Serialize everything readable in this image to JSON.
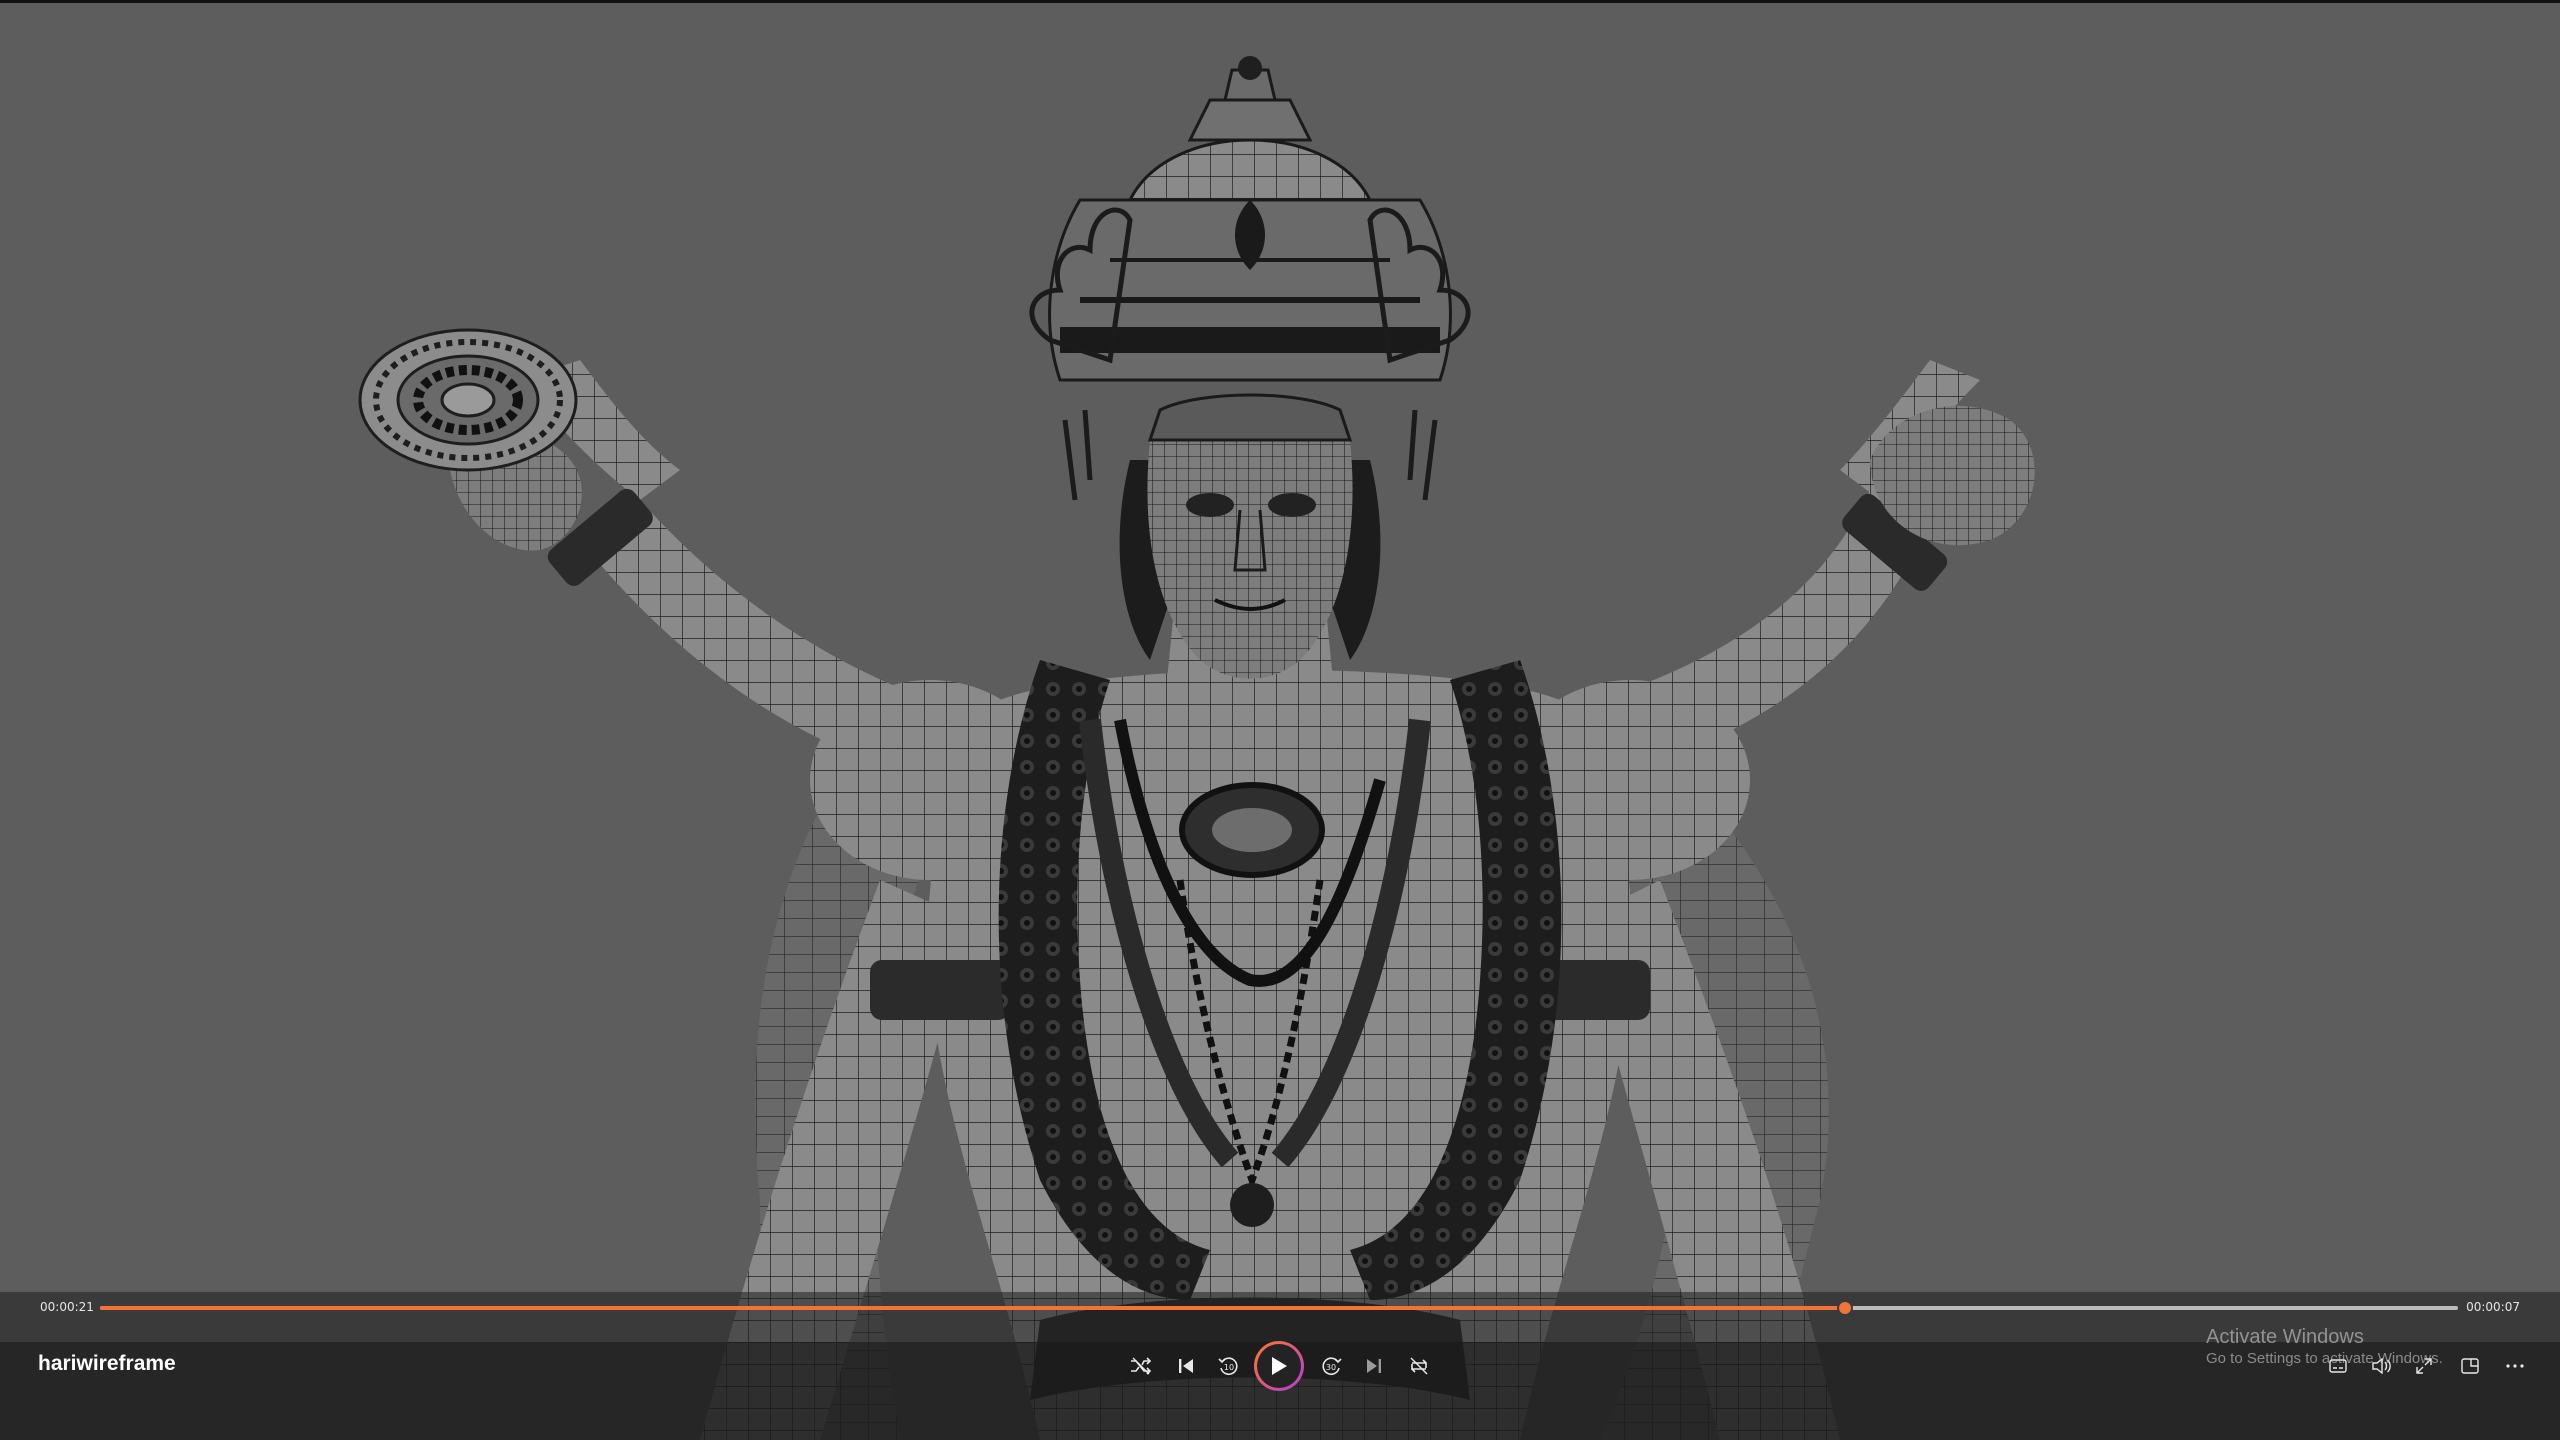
{
  "player": {
    "title": "hariwireframe",
    "time_elapsed": "00:00:21",
    "time_remaining": "00:00:07",
    "progress_fraction": 0.74,
    "accent_color": "#f0743a",
    "play_state": "paused"
  },
  "controls": [
    {
      "name": "shuffle-button",
      "icon": "shuffle-icon"
    },
    {
      "name": "previous-button",
      "icon": "skip-previous-icon"
    },
    {
      "name": "skip-back-button",
      "icon": "rewind-10-icon",
      "label": "10"
    },
    {
      "name": "play-button",
      "icon": "play-icon"
    },
    {
      "name": "skip-forward-button",
      "icon": "forward-30-icon",
      "label": "30"
    },
    {
      "name": "next-button",
      "icon": "skip-next-icon"
    },
    {
      "name": "repeat-button",
      "icon": "repeat-off-icon"
    }
  ],
  "right_controls": [
    {
      "name": "captions-button",
      "icon": "captions-icon"
    },
    {
      "name": "volume-button",
      "icon": "volume-icon"
    },
    {
      "name": "fullscreen-button",
      "icon": "expand-icon"
    },
    {
      "name": "miniplayer-button",
      "icon": "miniplayer-icon"
    },
    {
      "name": "more-button",
      "icon": "more-icon"
    }
  ],
  "watermark": {
    "title": "Activate Windows",
    "subtitle": "Go to Settings to activate Windows."
  },
  "colors": {
    "viewport_background": "#5d5d5d",
    "control_bar": "#1a1a1a",
    "play_ring_start": "#ff7a2a",
    "play_ring_end": "#b43ad8"
  }
}
